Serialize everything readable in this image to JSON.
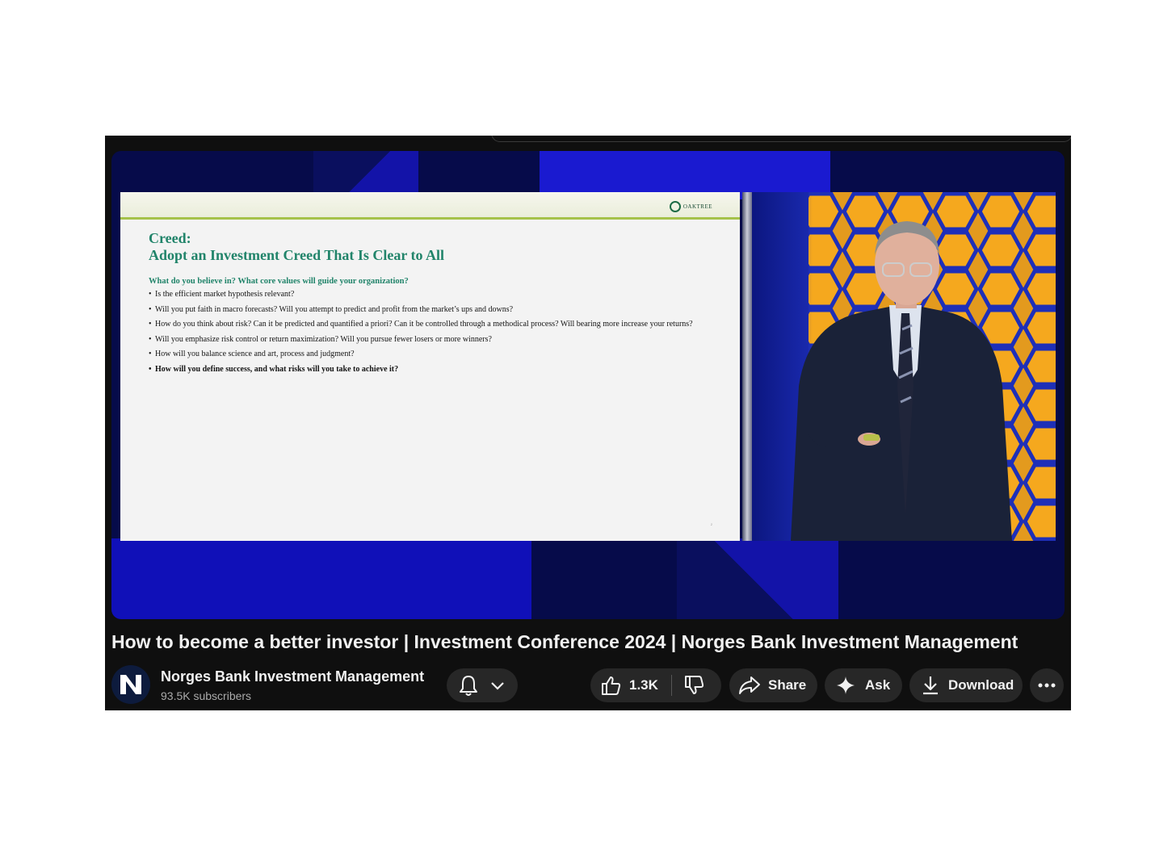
{
  "slide": {
    "logo_text": "OAKTREE",
    "title_line1": "Creed:",
    "title_line2": "Adopt an Investment Creed That Is Clear to All",
    "question": "What do you believe in?  What core values will guide your organization?",
    "bullets": [
      {
        "text": "Is the efficient market hypothesis relevant?",
        "bold": false
      },
      {
        "text": "Will you put faith in macro forecasts?  Will you attempt to predict and profit from the market’s ups and downs?",
        "bold": false
      },
      {
        "text": "How do you think about risk?  Can it be predicted and quantified a priori?  Can it be controlled through a methodical process?  Will bearing more increase your returns?",
        "bold": false
      },
      {
        "text": "Will you emphasize risk control or return maximization?  Will you pursue fewer losers or more winners?",
        "bold": false
      },
      {
        "text": "How will you balance science and art, process and judgment?",
        "bold": false
      },
      {
        "text": "How will you define success, and what risks will you take to achieve it?",
        "bold": true
      }
    ],
    "page_number": "2"
  },
  "video": {
    "title": "How to become a better investor | Investment Conference 2024 | Norges Bank Investment Management"
  },
  "channel": {
    "name": "Norges Bank Investment Management",
    "subscribers": "93.5K subscribers",
    "avatar_letter": "N"
  },
  "actions": {
    "like_count": "1.3K",
    "share_label": "Share",
    "ask_label": "Ask",
    "download_label": "Download"
  },
  "icons": {
    "bell": "bell-icon",
    "chevron": "chevron-down-icon",
    "like": "thumbs-up-icon",
    "dislike": "thumbs-down-icon",
    "share": "share-arrow-icon",
    "ask": "sparkle-icon",
    "download": "download-icon",
    "more": "more-horizontal-icon"
  },
  "colors": {
    "page_background": "#0f0f0f",
    "pill_background": "#272727",
    "slide_title": "#21846a",
    "text_primary": "#f1f1f1",
    "text_secondary": "#aaaaaa"
  }
}
